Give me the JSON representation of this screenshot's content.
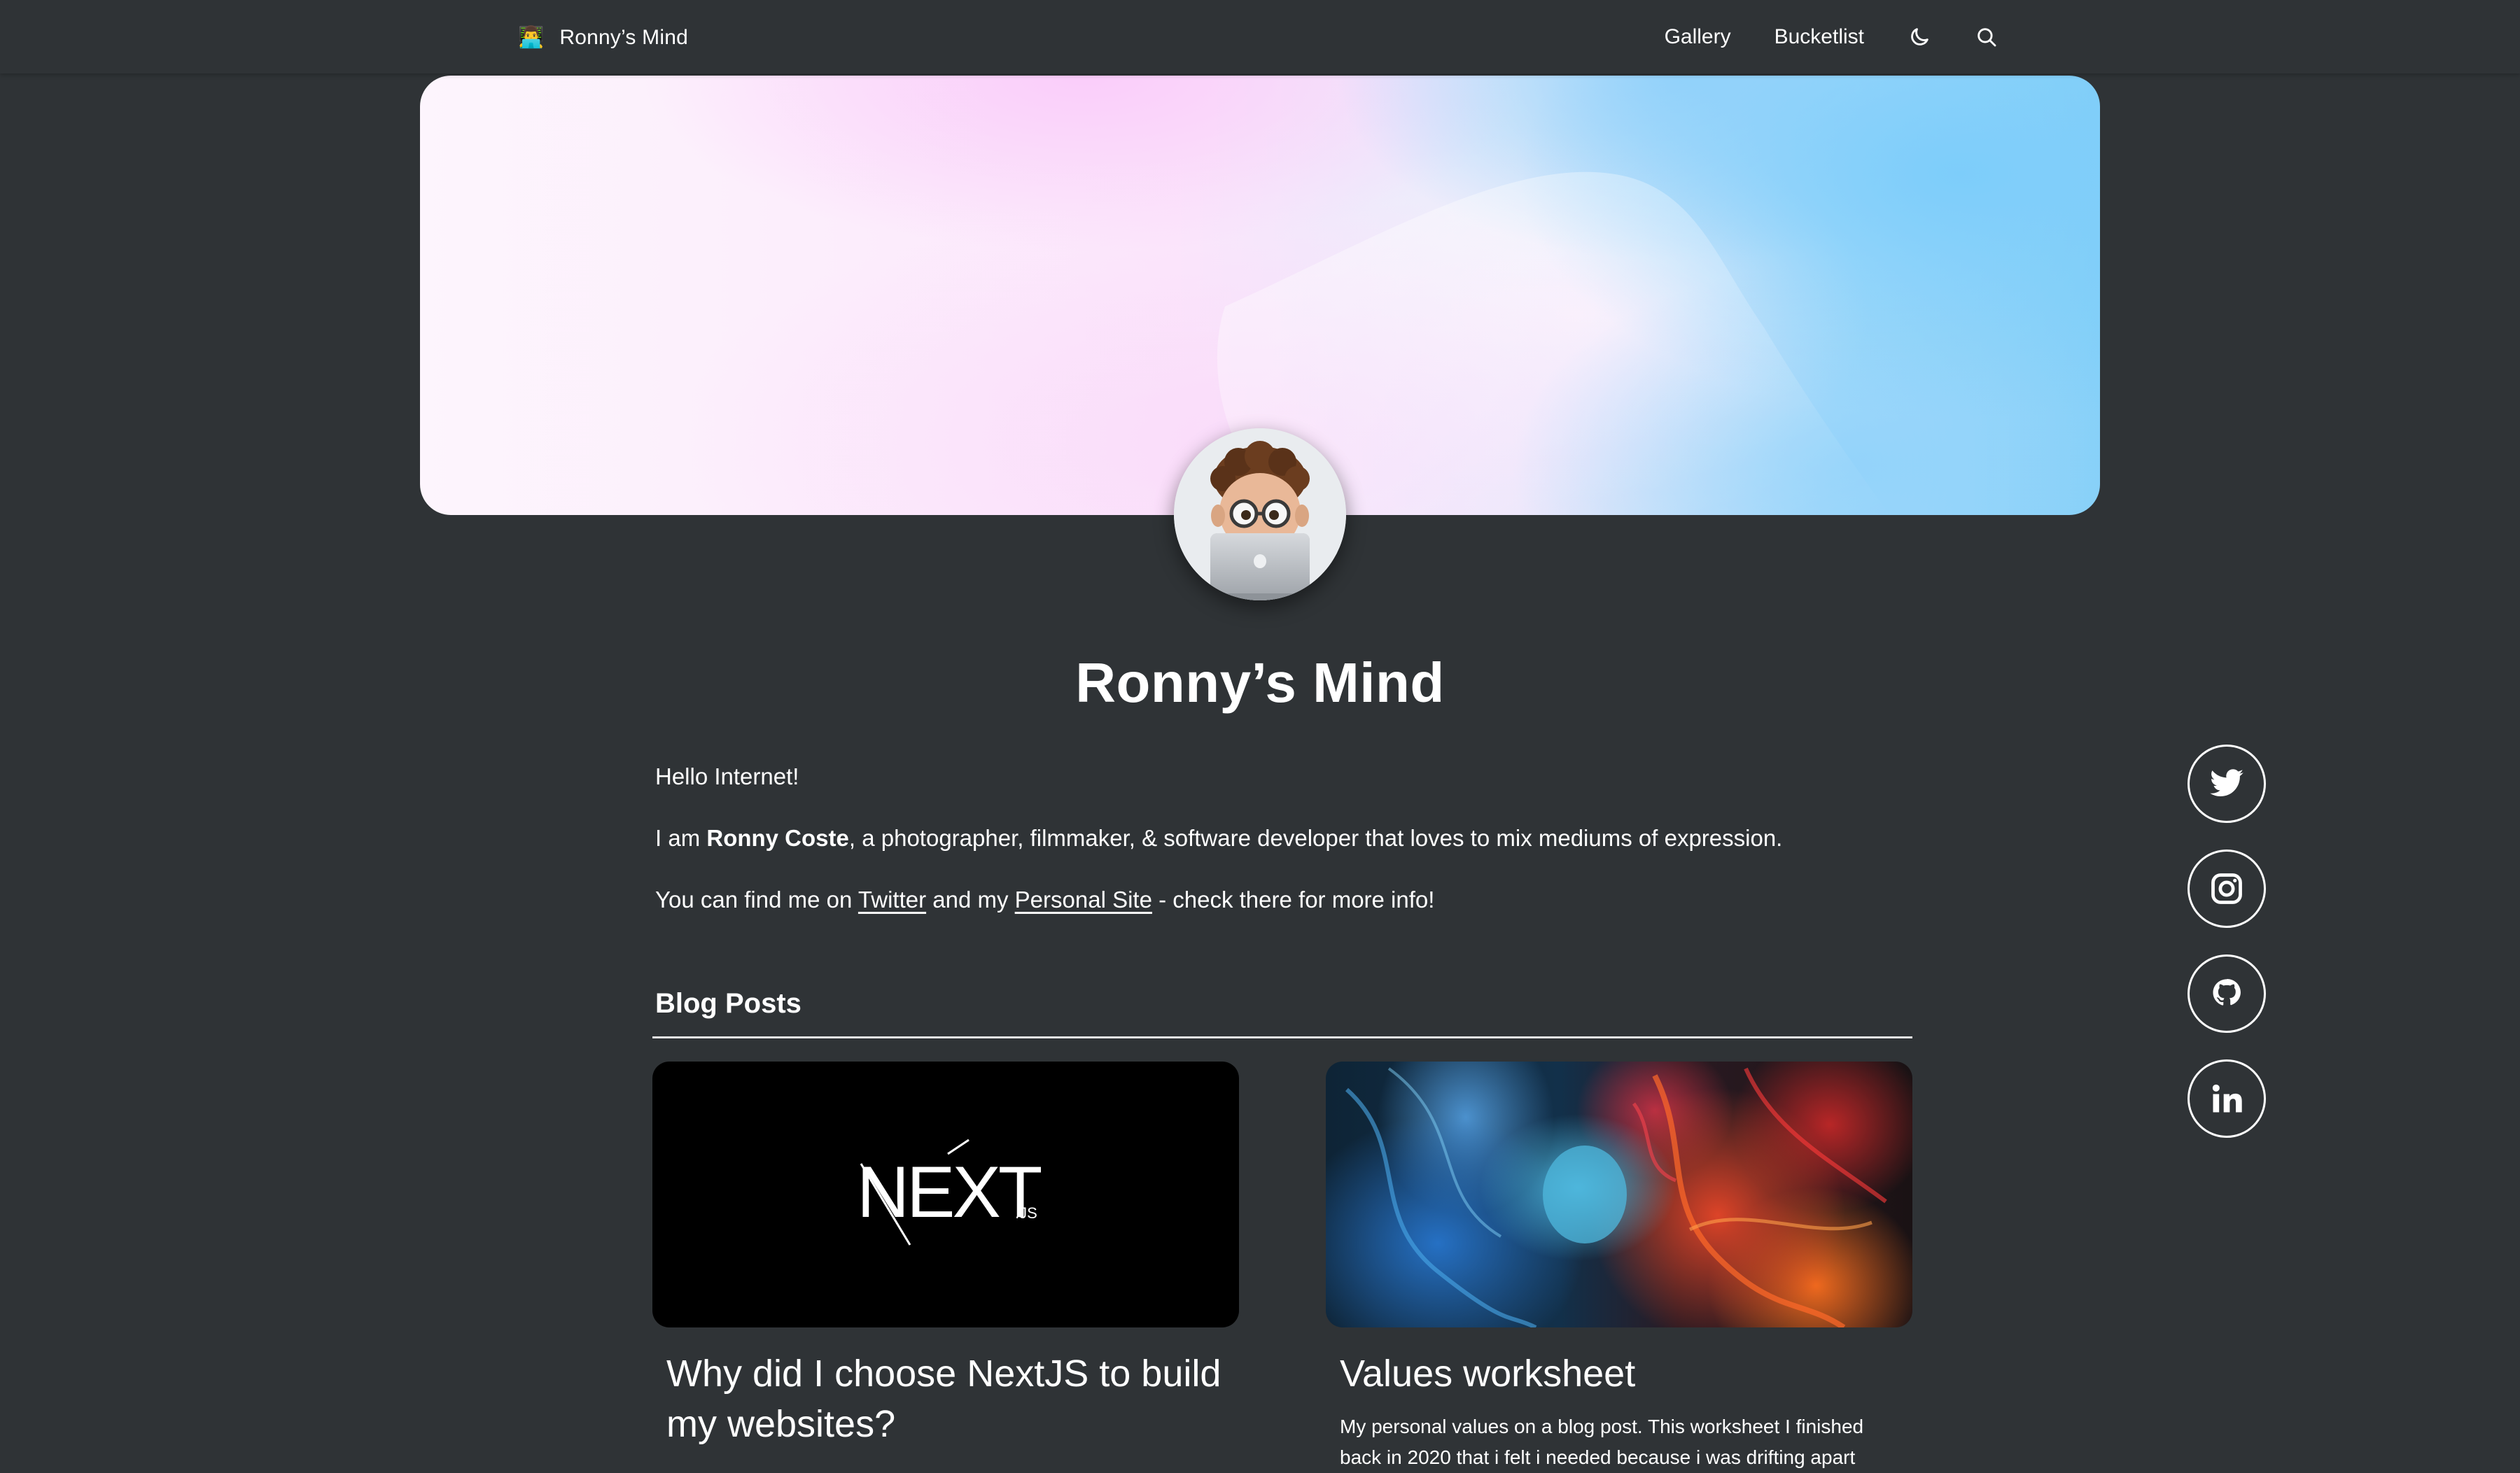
{
  "nav": {
    "brand_emoji": "👨‍💻",
    "brand_label": "Ronny’s Mind",
    "links": [
      {
        "label": "Gallery"
      },
      {
        "label": "Bucketlist"
      }
    ],
    "theme_toggle_icon": "moon-icon",
    "search_icon": "search-icon"
  },
  "hero": {
    "colors": [
      "#fdf5fd",
      "#fbe7fb",
      "#a9dcf9",
      "#84d0f8"
    ]
  },
  "avatar": {
    "icon": "memoji-laptop-avatar"
  },
  "page_title": "Ronny’s Mind",
  "intro": {
    "greeting": "Hello Internet!",
    "line2_prefix": "I am ",
    "line2_name": "Ronny Coste",
    "line2_suffix": ", a photographer, filmmaker, & software developer that loves to mix mediums of expression.",
    "line3_prefix": "You can find me on ",
    "line3_link1": "Twitter",
    "line3_mid": " and my ",
    "line3_link2": "Personal Site",
    "line3_suffix": " - check there for more info!"
  },
  "social": [
    {
      "icon": "twitter-icon"
    },
    {
      "icon": "instagram-icon"
    },
    {
      "icon": "github-icon"
    },
    {
      "icon": "linkedin-icon"
    }
  ],
  "blog": {
    "section_title": "Blog Posts",
    "posts": [
      {
        "image_text": "NEXT",
        "image_subtext": ".JS",
        "title": "Why did I choose NextJS to build my websites?"
      },
      {
        "title": "Values worksheet",
        "excerpt": "My personal values on a blog post. This worksheet I finished back in 2020 that i felt i needed because i was drifting apart"
      }
    ]
  },
  "colors": {
    "background": "#2f3336",
    "text": "#ffffff"
  }
}
